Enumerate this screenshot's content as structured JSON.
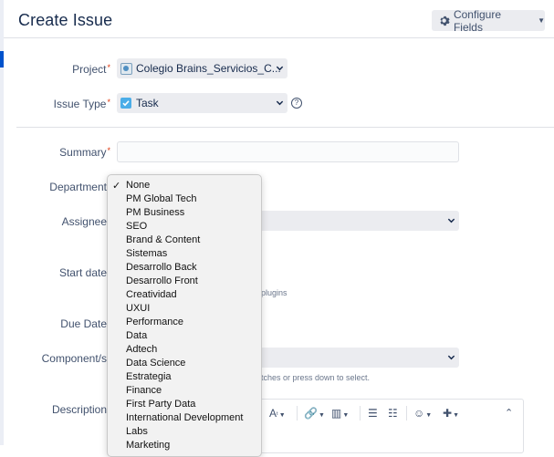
{
  "header": {
    "title": "Create Issue",
    "configure_label": "Configure Fields"
  },
  "fields": {
    "project": {
      "label": "Project",
      "value": "Colegio Brains_Servicios_C..."
    },
    "issue_type": {
      "label": "Issue Type",
      "value": "Task"
    },
    "summary": {
      "label": "Summary"
    },
    "department": {
      "label": "Department"
    },
    "assignee": {
      "label": "Assignee"
    },
    "start_date": {
      "label": "Start date",
      "hint_fragment": "plugins"
    },
    "due_date": {
      "label": "Due Date"
    },
    "components": {
      "label": "Component/s",
      "hint_fragment": "tches or press down to select."
    },
    "description": {
      "label": "Description"
    }
  },
  "required_marker": "*",
  "department_dropdown": {
    "selected": "None",
    "options": [
      "None",
      "PM Global Tech",
      "PM Business",
      "SEO",
      "Brand & Content",
      "Sistemas",
      "Desarrollo Back",
      "Desarrollo Front",
      "Creatividad",
      "UXUI",
      "Performance",
      "Data",
      "Adtech",
      "Data Science",
      "Estrategia",
      "Finance",
      "First Party Data",
      "International Development",
      "Labs",
      "Marketing"
    ]
  },
  "colors": {
    "accent": "#0052cc",
    "required": "#de350b",
    "label": "#42526e",
    "select_bg": "#ebecf0"
  }
}
